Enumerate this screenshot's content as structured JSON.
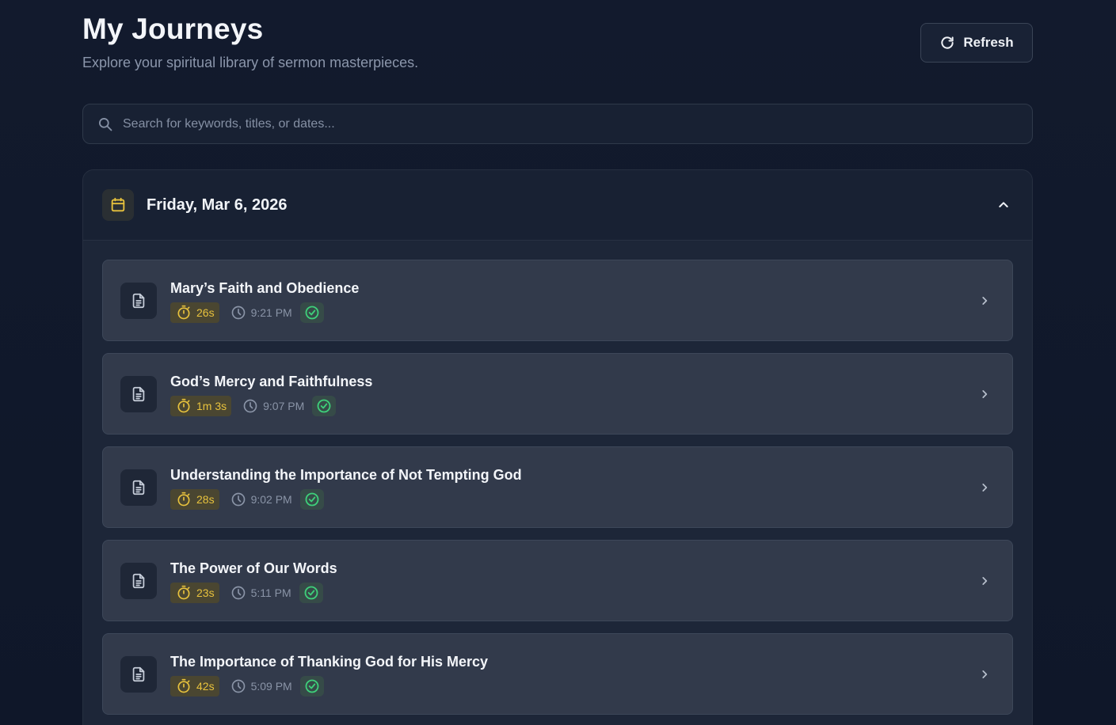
{
  "header": {
    "title": "My Journeys",
    "subtitle": "Explore your spiritual library of sermon masterpieces."
  },
  "toolbar": {
    "refresh_label": "Refresh"
  },
  "search": {
    "placeholder": "Search for keywords, titles, or dates...",
    "value": ""
  },
  "group": {
    "date": "Friday, Mar 6, 2026",
    "expanded": true,
    "items": [
      {
        "title": "Mary’s Faith and Obedience",
        "duration": "26s",
        "time": "9:21 PM",
        "status": "completed"
      },
      {
        "title": "God’s Mercy and Faithfulness",
        "duration": "1m 3s",
        "time": "9:07 PM",
        "status": "completed"
      },
      {
        "title": "Understanding the Importance of Not Tempting God",
        "duration": "28s",
        "time": "9:02 PM",
        "status": "completed"
      },
      {
        "title": "The Power of Our Words",
        "duration": "23s",
        "time": "5:11 PM",
        "status": "completed"
      },
      {
        "title": "The Importance of Thanking God for His Mercy",
        "duration": "42s",
        "time": "5:09 PM",
        "status": "completed"
      }
    ]
  },
  "icons": {
    "refresh": "refresh-icon",
    "search": "search-icon",
    "calendar": "calendar-icon",
    "collapse": "chevron-up-icon",
    "document": "document-icon",
    "timer": "stopwatch-icon",
    "clock": "clock-icon",
    "check": "check-circle-icon",
    "open": "chevron-right-icon"
  },
  "colors": {
    "background": "#111a2c",
    "card": "#323a4b",
    "accent_yellow": "#e8c23d",
    "success_green": "#3ecf7a",
    "muted_text": "#8a94a7"
  }
}
